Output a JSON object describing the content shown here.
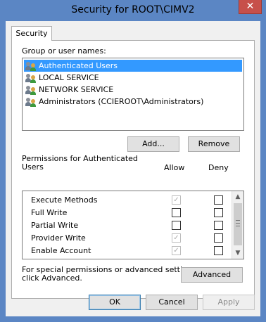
{
  "window": {
    "title": "Security for ROOT\\CIMV2",
    "close_glyph": "✕"
  },
  "tabs": [
    {
      "label": "Security"
    }
  ],
  "group_label": "Group or user names:",
  "users": [
    {
      "name": "Authenticated Users",
      "selected": true
    },
    {
      "name": "LOCAL SERVICE",
      "selected": false
    },
    {
      "name": "NETWORK SERVICE",
      "selected": false
    },
    {
      "name": "Administrators (CCIEROOT\\Administrators)",
      "selected": false
    }
  ],
  "buttons": {
    "add": "Add...",
    "remove": "Remove",
    "advanced": "Advanced",
    "ok": "OK",
    "cancel": "Cancel",
    "apply": "Apply"
  },
  "permissions": {
    "label_line1": "Permissions for Authenticated",
    "label_line2": "Users",
    "allow_header": "Allow",
    "deny_header": "Deny",
    "rows": [
      {
        "name": "Execute Methods",
        "allow": true,
        "allow_disabled": true,
        "deny": false
      },
      {
        "name": "Full Write",
        "allow": false,
        "allow_disabled": false,
        "deny": false
      },
      {
        "name": "Partial Write",
        "allow": false,
        "allow_disabled": false,
        "deny": false
      },
      {
        "name": "Provider Write",
        "allow": true,
        "allow_disabled": true,
        "deny": false
      },
      {
        "name": "Enable Account",
        "allow": true,
        "allow_disabled": true,
        "deny": false
      }
    ]
  },
  "advanced_note_line1": "For special permissions or advanced settings,",
  "advanced_note_line2": "click Advanced.",
  "icons": {
    "user_group": "user-group-icon",
    "scroll_up": "▲",
    "scroll_down": "▼",
    "check": "✓"
  }
}
